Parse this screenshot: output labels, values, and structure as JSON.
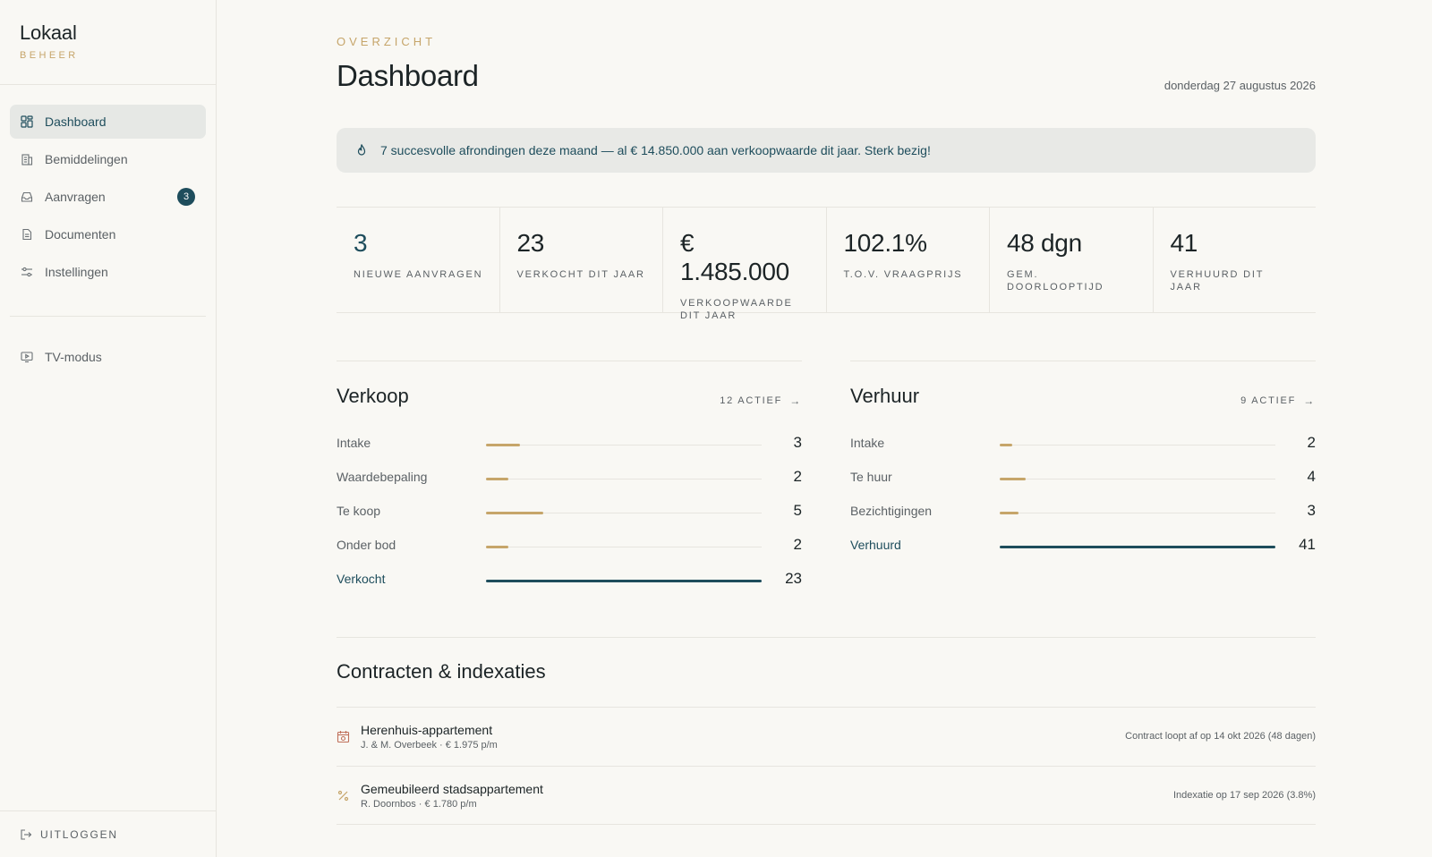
{
  "brand": {
    "name": "Lokaal",
    "subtitle": "BEHEER"
  },
  "sidebar": {
    "items": [
      {
        "label": "Dashboard",
        "icon": "grid-icon",
        "active": true
      },
      {
        "label": "Bemiddelingen",
        "icon": "building-icon"
      },
      {
        "label": "Aanvragen",
        "icon": "inbox-icon",
        "badge": "3"
      },
      {
        "label": "Documenten",
        "icon": "document-icon"
      },
      {
        "label": "Instellingen",
        "icon": "sliders-icon"
      }
    ],
    "secondary": [
      {
        "label": "TV-modus",
        "icon": "tv-icon"
      }
    ],
    "logout_label": "UITLOGGEN"
  },
  "header": {
    "eyebrow": "OVERZICHT",
    "title": "Dashboard",
    "date": "donderdag 27 augustus 2026"
  },
  "banner": {
    "text": "7 succesvolle afrondingen deze maand — al € 14.850.000 aan verkoopwaarde dit jaar. Sterk bezig!"
  },
  "stats": [
    {
      "value": "3",
      "label": "NIEUWE AANVRAGEN",
      "accent": true
    },
    {
      "value": "23",
      "label": "VERKOCHT DIT JAAR"
    },
    {
      "value": "€ 1.485.000",
      "label": "VERKOOPWAARDE DIT JAAR"
    },
    {
      "value": "102.1%",
      "label": "T.O.V. VRAAGPRIJS"
    },
    {
      "value": "48 dgn",
      "label": "GEM. DOORLOOPTIJD"
    },
    {
      "value": "41",
      "label": "VERHUURD DIT JAAR"
    }
  ],
  "verkoop": {
    "title": "Verkoop",
    "link": "12 ACTIEF",
    "max": 23,
    "rows": [
      {
        "label": "Intake",
        "value": 3
      },
      {
        "label": "Waardebepaling",
        "value": 2
      },
      {
        "label": "Te koop",
        "value": 5
      },
      {
        "label": "Onder bod",
        "value": 2
      },
      {
        "label": "Verkocht",
        "value": 23,
        "highlight": true
      }
    ]
  },
  "verhuur": {
    "title": "Verhuur",
    "link": "9 ACTIEF",
    "max": 41,
    "rows": [
      {
        "label": "Intake",
        "value": 2
      },
      {
        "label": "Te huur",
        "value": 4
      },
      {
        "label": "Bezichtigingen",
        "value": 3
      },
      {
        "label": "Verhuurd",
        "value": 41,
        "highlight": true
      }
    ]
  },
  "contracts": {
    "title": "Contracten & indexaties",
    "items": [
      {
        "name": "Herenhuis-appartement",
        "sub": "J. & M. Overbeek · € 1.975 p/m",
        "status": "Contract loopt af op 14 okt 2026 (48 dagen)",
        "icon": "calendar-icon",
        "icon_color": "#c0705a"
      },
      {
        "name": "Gemeubileerd stadsappartement",
        "sub": "R. Doornbos · € 1.780 p/m",
        "status": "Indexatie op 17 sep 2026 (3.8%)",
        "icon": "percent-icon",
        "icon_color": "#c6a56a"
      }
    ]
  },
  "colors": {
    "accent": "#1e4d5c",
    "gold": "#c6a56a",
    "background": "#f9f8f4"
  }
}
